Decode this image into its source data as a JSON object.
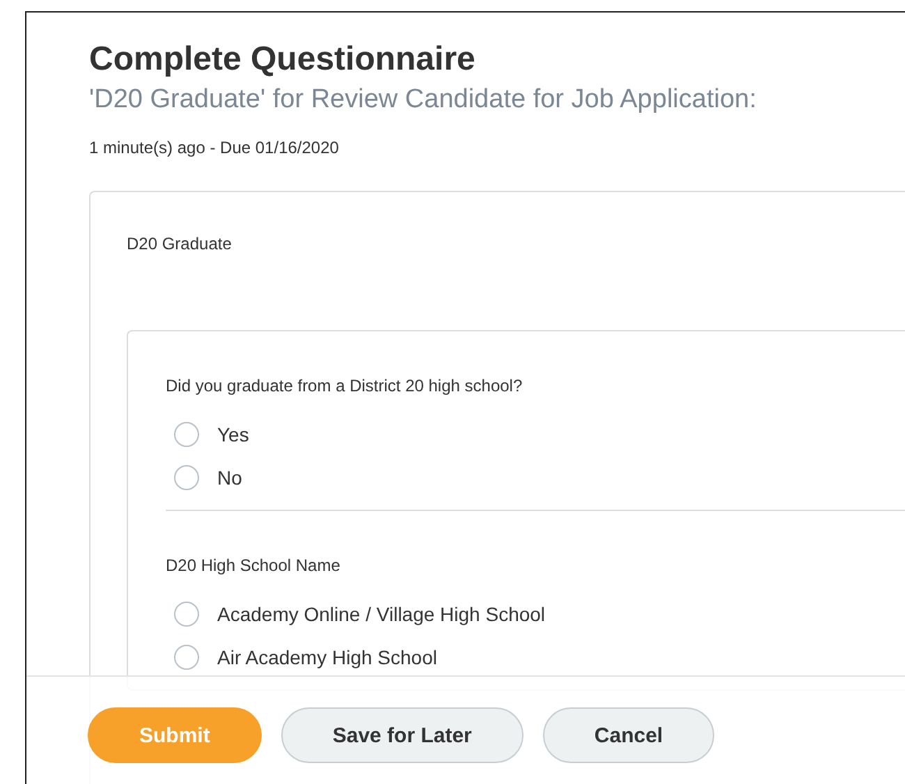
{
  "header": {
    "title": "Complete Questionnaire",
    "subtitle": "'D20 Graduate' for Review Candidate for Job Application:",
    "meta": "1 minute(s) ago - Due 01/16/2020"
  },
  "section": {
    "title": "D20 Graduate",
    "questions": [
      {
        "prompt": "Did you graduate from a District 20 high school?",
        "options": [
          {
            "label": "Yes",
            "selected": false
          },
          {
            "label": "No",
            "selected": false
          }
        ]
      },
      {
        "prompt": "D20 High School Name",
        "options": [
          {
            "label": "Academy Online / Village High School",
            "selected": false
          },
          {
            "label": "Air Academy High School",
            "selected": false
          }
        ]
      }
    ]
  },
  "buttons": [
    {
      "label": "Submit",
      "kind": "primary"
    },
    {
      "label": "Save for Later",
      "kind": "secondary"
    },
    {
      "label": "Cancel",
      "kind": "secondary"
    }
  ]
}
